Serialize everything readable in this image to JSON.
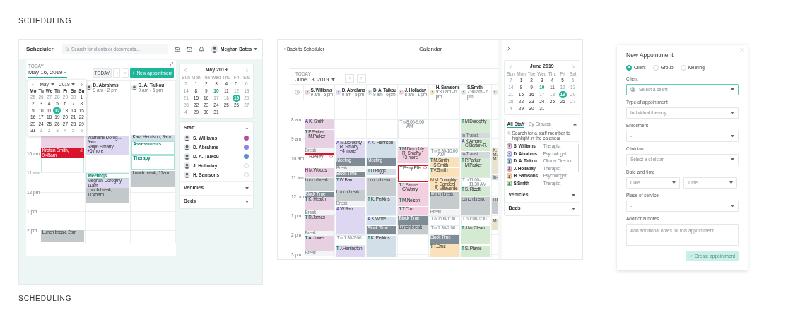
{
  "heading_top": "SCHEDULING",
  "heading_bottom": "SCHEDULING",
  "scheduler": {
    "app_title": "Scheduler",
    "search": {
      "placeholder": "Search for clients or documents..."
    },
    "user_name": "Meghan Bates",
    "calendar": {
      "today_label": "TODAY",
      "date": "May 16, 2019",
      "today_button": "TODAY",
      "new_button": "New appointment",
      "datepicker": {
        "month": "May",
        "year": "2019",
        "weekdays": [
          "Mo",
          "Tu",
          "We",
          "Th",
          "Fr",
          "Sa",
          "Su"
        ],
        "weeks": [
          [
            {
              "d": "25",
              "kind": "muted",
              "selected": false
            },
            {
              "d": "26",
              "kind": "muted",
              "selected": false
            },
            {
              "d": "27",
              "kind": "muted",
              "selected": false
            },
            {
              "d": "28",
              "kind": "muted",
              "selected": false
            },
            {
              "d": "29",
              "kind": "muted",
              "selected": false
            },
            {
              "d": "30",
              "kind": "muted",
              "selected": false
            },
            {
              "d": "1",
              "kind": "normal",
              "selected": false
            }
          ],
          [
            {
              "d": "2",
              "kind": "normal",
              "selected": false
            },
            {
              "d": "3",
              "kind": "normal",
              "selected": false
            },
            {
              "d": "4",
              "kind": "normal",
              "selected": false
            },
            {
              "d": "5",
              "kind": "normal",
              "selected": false
            },
            {
              "d": "6",
              "kind": "normal",
              "selected": false
            },
            {
              "d": "7",
              "kind": "normal",
              "selected": false
            },
            {
              "d": "8",
              "kind": "normal",
              "selected": false
            }
          ],
          [
            {
              "d": "9",
              "kind": "normal",
              "selected": false
            },
            {
              "d": "10",
              "kind": "normal",
              "selected": false
            },
            {
              "d": "11",
              "kind": "normal",
              "selected": false
            },
            {
              "d": "12",
              "kind": "normal",
              "selected": true
            },
            {
              "d": "13",
              "kind": "normal",
              "selected": false
            },
            {
              "d": "14",
              "kind": "normal",
              "selected": false
            },
            {
              "d": "15",
              "kind": "normal",
              "selected": false
            }
          ],
          [
            {
              "d": "16",
              "kind": "normal",
              "selected": false
            },
            {
              "d": "17",
              "kind": "normal",
              "selected": false
            },
            {
              "d": "18",
              "kind": "normal",
              "selected": false
            },
            {
              "d": "19",
              "kind": "normal",
              "selected": false
            },
            {
              "d": "20",
              "kind": "normal",
              "selected": false
            },
            {
              "d": "21",
              "kind": "normal",
              "selected": false
            },
            {
              "d": "22",
              "kind": "normal",
              "selected": false
            }
          ],
          [
            {
              "d": "23",
              "kind": "normal",
              "selected": false
            },
            {
              "d": "24",
              "kind": "normal",
              "selected": false
            },
            {
              "d": "25",
              "kind": "normal",
              "selected": false
            },
            {
              "d": "26",
              "kind": "normal",
              "selected": false
            },
            {
              "d": "27",
              "kind": "normal",
              "selected": false
            },
            {
              "d": "28",
              "kind": "normal",
              "selected": false
            },
            {
              "d": "29",
              "kind": "normal",
              "selected": false
            }
          ],
          [
            {
              "d": "31",
              "kind": "normal",
              "selected": false
            },
            {
              "d": "1",
              "kind": "muted",
              "selected": false
            },
            {
              "d": "2",
              "kind": "muted",
              "selected": false
            },
            {
              "d": "3",
              "kind": "muted",
              "selected": false
            },
            {
              "d": "4",
              "kind": "muted",
              "selected": false
            },
            {
              "d": "5",
              "kind": "muted",
              "selected": false
            },
            {
              "d": "6",
              "kind": "muted",
              "selected": false
            }
          ]
        ]
      },
      "hours": [
        "10 am",
        "11 am",
        "12 pm",
        "1 pm",
        "2 pm"
      ],
      "columns": [
        {
          "events": [
            {
              "kind": "outline"
            },
            {
              "kind": "appt",
              "color": "#ecd3e3"
            },
            {
              "kind": "alert",
              "lines": [
                "Kristen Smith, 9:45am"
              ]
            },
            {
              "kind": "lunch",
              "lines": [
                "Lunch break, 2pm"
              ]
            }
          ]
        },
        {
          "staff": {
            "name": "D. Abrahms",
            "hours": "9 am - 2 pm"
          },
          "events": [
            {
              "kind": "appt",
              "color": "#ddd7f2",
              "lines": [
                "Warriane Dorog..., 9am",
                "Ralph Smarty",
                "+6 more"
              ]
            },
            {
              "kind": "group",
              "lines": [
                "Meetings"
              ]
            },
            {
              "kind": "appt",
              "color": "#ddd7f2",
              "lines": [
                "Meghan Dorogthy, 11am"
              ]
            },
            {
              "kind": "lunch",
              "lines": [
                "Lunch break, 11:45am"
              ]
            }
          ]
        },
        {
          "staff": {
            "name": "D. A. Taikou",
            "hours": "9 am - 6 pm"
          },
          "events": [
            {
              "kind": "appt",
              "color": "#d3dfe8",
              "lines": [
                "Kara Henrison, 9am"
              ]
            },
            {
              "kind": "group",
              "lines": [
                "Assessments"
              ]
            },
            {
              "kind": "group",
              "lines": [
                "Therapy"
              ]
            },
            {
              "kind": "lunch",
              "lines": [
                "Lunch break, 11am"
              ]
            }
          ]
        }
      ]
    },
    "mini_calendar": {
      "title": "May 2019",
      "weekdays": [
        "Sun",
        "Mon",
        "Tue",
        "Wed",
        "Thu",
        "Fri",
        "Sat"
      ],
      "weeks": [
        [
          {
            "d": "7",
            "kind": "muted",
            "selected": false
          },
          {
            "d": "1",
            "kind": "normal",
            "selected": false
          },
          {
            "d": "2",
            "kind": "normal",
            "selected": false
          },
          {
            "d": "3",
            "kind": "normal",
            "selected": false
          },
          {
            "d": "4",
            "kind": "normal",
            "selected": false
          },
          {
            "d": "5",
            "kind": "normal",
            "selected": false
          },
          {
            "d": "6",
            "kind": "muted",
            "selected": false
          }
        ],
        [
          {
            "d": "14",
            "kind": "muted",
            "selected": false
          },
          {
            "d": "8",
            "kind": "normal",
            "selected": false
          },
          {
            "d": "9",
            "kind": "normal",
            "selected": false
          },
          {
            "d": "10",
            "kind": "today",
            "selected": false
          },
          {
            "d": "11",
            "kind": "normal",
            "selected": false
          },
          {
            "d": "12",
            "kind": "muted",
            "selected": false
          },
          {
            "d": "13",
            "kind": "muted",
            "selected": false
          }
        ],
        [
          {
            "d": "21",
            "kind": "muted",
            "selected": false
          },
          {
            "d": "15",
            "kind": "normal",
            "selected": false
          },
          {
            "d": "16",
            "kind": "normal",
            "selected": false
          },
          {
            "d": "17",
            "kind": "muted",
            "selected": false
          },
          {
            "d": "18",
            "kind": "muted",
            "selected": false
          },
          {
            "d": "19",
            "kind": "normal",
            "selected": true
          },
          {
            "d": "20",
            "kind": "muted",
            "selected": false
          }
        ],
        [
          {
            "d": "28",
            "kind": "muted",
            "selected": false
          },
          {
            "d": "22",
            "kind": "normal",
            "selected": false
          },
          {
            "d": "23",
            "kind": "normal",
            "selected": false
          },
          {
            "d": "24",
            "kind": "normal",
            "selected": false
          },
          {
            "d": "25",
            "kind": "normal",
            "selected": false
          },
          {
            "d": "26",
            "kind": "normal",
            "selected": false
          },
          {
            "d": "27",
            "kind": "muted",
            "selected": false
          }
        ],
        [
          {
            "d": "4",
            "kind": "muted",
            "selected": false
          },
          {
            "d": "29",
            "kind": "normal",
            "selected": false
          },
          {
            "d": "30",
            "kind": "normal",
            "selected": false
          },
          {
            "d": "31",
            "kind": "normal",
            "selected": false
          }
        ]
      ]
    },
    "sections": [
      {
        "title": "Staff",
        "expanded": true,
        "items": [
          {
            "name": "S. Williams",
            "checked": true,
            "color": "#b04fa0"
          },
          {
            "name": "D. Abrahms",
            "checked": true,
            "color": "#8f84e6"
          },
          {
            "name": "D. A. Taikou",
            "checked": true,
            "color": "#5f8ec4"
          },
          {
            "name": "J. Holladay",
            "checked": false
          },
          {
            "name": "H. Samsons",
            "checked": false
          }
        ]
      },
      {
        "title": "Vehicles",
        "expanded": false
      },
      {
        "title": "Beds",
        "expanded": false
      }
    ]
  },
  "calendar_screen": {
    "back_link": "Back to Scheduler",
    "title": "Calendar",
    "today_label": "TODAY",
    "date": "June 13, 2019",
    "hours": [
      "8 am",
      "9 am",
      "10 am",
      "11 am",
      "12 pm",
      "1 pm",
      "2 pm",
      "3 pm"
    ],
    "columns": [
      {
        "staff": {
          "name": "S. Williams",
          "hours": "9 am - 5 pm"
        },
        "color": "#e6d0e2",
        "events": [
          {
            "kind": "appt",
            "type": "A",
            "lines": [
              "K. Smith"
            ]
          },
          {
            "kind": "appt",
            "type": "T",
            "lines": [
              "P.Parker",
              "M.Parker"
            ]
          },
          {
            "kind": "break",
            "lines": [
              "Break"
            ]
          },
          {
            "kind": "alert",
            "type": "T",
            "lines": [
              "R.Perry"
            ]
          },
          {
            "kind": "appt",
            "type": "H",
            "lines": [
              "M.Woods"
            ]
          },
          {
            "kind": "lunch",
            "lines": [
              "Lunch break"
            ]
          },
          {
            "kind": "block",
            "lines": [
              "Block Time"
            ]
          },
          {
            "kind": "appt",
            "type": "T",
            "lines": [
              "K. Hearth"
            ]
          },
          {
            "kind": "break",
            "lines": [
              "Break"
            ]
          },
          {
            "kind": "appt",
            "type": "T",
            "lines": [
              "R.James"
            ]
          },
          {
            "kind": "break",
            "lines": [
              "Break"
            ]
          },
          {
            "kind": "appt",
            "type": "T",
            "lines": [
              "A. Jones"
            ]
          },
          {
            "kind": "break",
            "lines": [
              "Break"
            ]
          }
        ]
      },
      {
        "staff": {
          "name": "D. Abrahms",
          "hours": "9 am - 5 pm"
        },
        "color": "#ddd7f2",
        "events": [
          {
            "kind": "appt",
            "type": "A",
            "lines": [
              "M.Doroghty",
              "R. Smarty",
              "+4 more"
            ]
          },
          {
            "kind": "meeting",
            "lines": [
              "Meeting"
            ]
          },
          {
            "kind": "break",
            "lines": [
              "Break"
            ]
          },
          {
            "kind": "block",
            "lines": [
              "Block Time"
            ]
          },
          {
            "kind": "appt",
            "type": "T",
            "lines": [
              "W.Barr"
            ]
          },
          {
            "kind": "lunch",
            "lines": [
              "Lunch break"
            ]
          },
          {
            "kind": "break",
            "lines": [
              "Break"
            ]
          },
          {
            "kind": "appt",
            "type": "A",
            "lines": [
              "W.Barr"
            ]
          },
          {
            "kind": "open",
            "type": "T",
            "lines": [
              "1:30-2:00"
            ]
          },
          {
            "kind": "appt",
            "type": "T",
            "lines": [
              "J.Harrington"
            ]
          }
        ]
      },
      {
        "staff": {
          "name": "D. A. Taikou",
          "hours": "9 am - 6 pm"
        },
        "color": "#d3dfe8",
        "events": [
          {
            "kind": "appt",
            "type": "A",
            "lines": [
              "K. Henrison"
            ]
          },
          {
            "kind": "meeting",
            "lines": [
              "Meeting"
            ]
          },
          {
            "kind": "appt",
            "type": "T",
            "lines": [
              "D.Riggs"
            ]
          },
          {
            "kind": "lunch",
            "lines": [
              "Lunch break"
            ]
          },
          {
            "kind": "appt",
            "type": "T",
            "lines": [
              "K. Perkins"
            ]
          },
          {
            "kind": "appt",
            "type": "A",
            "lines": [
              "K.White"
            ]
          },
          {
            "kind": "block",
            "lines": [
              "Block Time"
            ]
          },
          {
            "kind": "appt",
            "type": "T",
            "lines": [
              "K. Perkins"
            ]
          }
        ]
      },
      {
        "staff": {
          "name": "J. Holladay",
          "hours": "8 am - 1 pm"
        },
        "color": "#f3d0e1",
        "events": [
          {
            "kind": "open",
            "type": "T",
            "lines": [
              "8:00-9:00 AM"
            ]
          },
          {
            "kind": "appt",
            "type": "T",
            "lines": [
              "M.Doroghty",
              "R. Smarty",
              "+3 more"
            ]
          },
          {
            "kind": "alert",
            "type": "T",
            "lines": [
              "Perry Ellis"
            ]
          },
          {
            "kind": "appt",
            "type": "T",
            "lines": [
              "J.Farmer",
              "G.Warry"
            ]
          },
          {
            "kind": "appt",
            "type": "T",
            "lines": [
              "M.Nelson"
            ]
          },
          {
            "kind": "appt",
            "type": "T",
            "lines": [
              "T.Cruz"
            ]
          },
          {
            "kind": "block",
            "lines": [
              "Block Time"
            ]
          },
          {
            "kind": "lunch",
            "lines": [
              "Lunch break"
            ]
          }
        ]
      },
      {
        "staff": {
          "name": "H. Samsons",
          "hours": "9:30 am - 6 pm"
        },
        "color": "#fbe1b9",
        "events": [
          {
            "kind": "open",
            "type": "T",
            "lines": [
              "9:30-10:00 AM"
            ]
          },
          {
            "kind": "appt",
            "type": "T",
            "lines": [
              "M.Smith",
              "S.Smith"
            ]
          },
          {
            "kind": "appt",
            "type": "T",
            "lines": [
              "V.Smith"
            ]
          },
          {
            "kind": "appt",
            "type": "M",
            "lines": [
              "M.Doroghty",
              "S. Sanders",
              "A. Villaverde"
            ]
          },
          {
            "kind": "lunch",
            "lines": [
              "Lunch break"
            ]
          },
          {
            "kind": "break",
            "lines": [
              "Break"
            ]
          },
          {
            "kind": "open",
            "type": "T",
            "lines": [
              "1:00-1:30"
            ]
          },
          {
            "kind": "open",
            "type": "T",
            "lines": [
              "1:30-2:00"
            ]
          },
          {
            "kind": "block",
            "lines": [
              "Block Time"
            ]
          },
          {
            "kind": "appt",
            "type": "T",
            "lines": [
              "T.Cruz"
            ]
          }
        ]
      },
      {
        "staff": {
          "name": "S.Smith",
          "hours": "7:30 am - 6 pm"
        },
        "color": "#d5ead3",
        "events": [
          {
            "kind": "appt",
            "type": "T",
            "lines": [
              "M.Doroghty"
            ]
          },
          {
            "kind": "transit",
            "lines": [
              "In-Transit"
            ]
          },
          {
            "kind": "appt",
            "type": "A",
            "lines": [
              "K.Amaro",
              "C.Barton-R."
            ]
          },
          {
            "kind": "transit",
            "lines": [
              "In-Transit"
            ]
          },
          {
            "kind": "appt",
            "type": "T",
            "lines": [
              "P.Parker",
              "M.Parker"
            ]
          },
          {
            "kind": "open",
            "type": "T",
            "lines": [
              "11:00-11:30 AM"
            ]
          },
          {
            "kind": "appt",
            "type": "T",
            "lines": [
              "S. Ricetti"
            ]
          },
          {
            "kind": "lunch",
            "lines": [
              "Lunch break"
            ]
          },
          {
            "kind": "open",
            "type": "T",
            "lines": [
              "1:00-1:30"
            ]
          },
          {
            "kind": "appt",
            "type": "T",
            "lines": [
              "J.McClean"
            ]
          },
          {
            "kind": "appt",
            "type": "T",
            "lines": [
              "S. Pierce"
            ]
          }
        ]
      },
      {
        "color": "#e8e3cf",
        "events": [
          {
            "kind": "appt",
            "lines": [
              "K.",
              "M.",
              "M."
            ]
          },
          {
            "kind": "transit",
            "lines": [
              "In-"
            ]
          },
          {
            "kind": "lunch",
            "lines": [
              "Lu"
            ]
          },
          {
            "kind": "appt",
            "lines": [
              "M."
            ]
          }
        ]
      }
    ],
    "mini_calendar": {
      "title": "June 2019",
      "weekdays": [
        "Sun",
        "Mon",
        "Tue",
        "Wed",
        "Thu",
        "Fri",
        "Sat"
      ],
      "weeks": [
        [
          {
            "d": "7",
            "kind": "muted",
            "selected": false
          },
          {
            "d": "1",
            "kind": "normal",
            "selected": false
          },
          {
            "d": "2",
            "kind": "normal",
            "selected": false
          },
          {
            "d": "3",
            "kind": "normal",
            "selected": false
          },
          {
            "d": "4",
            "kind": "normal",
            "selected": false
          },
          {
            "d": "5",
            "kind": "normal",
            "selected": false
          },
          {
            "d": "6",
            "kind": "muted",
            "selected": false
          }
        ],
        [
          {
            "d": "14",
            "kind": "muted",
            "selected": false
          },
          {
            "d": "8",
            "kind": "normal",
            "selected": false
          },
          {
            "d": "9",
            "kind": "normal",
            "selected": false
          },
          {
            "d": "10",
            "kind": "today",
            "selected": false
          },
          {
            "d": "11",
            "kind": "normal",
            "selected": false
          },
          {
            "d": "12",
            "kind": "muted",
            "selected": false
          },
          {
            "d": "13",
            "kind": "muted",
            "selected": false
          }
        ],
        [
          {
            "d": "21",
            "kind": "muted",
            "selected": false
          },
          {
            "d": "15",
            "kind": "normal",
            "selected": false
          },
          {
            "d": "16",
            "kind": "normal",
            "selected": false
          },
          {
            "d": "17",
            "kind": "muted",
            "selected": false
          },
          {
            "d": "18",
            "kind": "muted",
            "selected": false
          },
          {
            "d": "19",
            "kind": "normal",
            "selected": true
          },
          {
            "d": "20",
            "kind": "muted",
            "selected": false
          }
        ],
        [
          {
            "d": "28",
            "kind": "muted",
            "selected": false
          },
          {
            "d": "22",
            "kind": "normal",
            "selected": false
          },
          {
            "d": "23",
            "kind": "normal",
            "selected": false
          },
          {
            "d": "24",
            "kind": "normal",
            "selected": false
          },
          {
            "d": "25",
            "kind": "normal",
            "selected": false
          },
          {
            "d": "26",
            "kind": "normal",
            "selected": false
          },
          {
            "d": "27",
            "kind": "muted",
            "selected": false
          }
        ],
        [
          {
            "d": "4",
            "kind": "muted",
            "selected": false
          },
          {
            "d": "29",
            "kind": "normal",
            "selected": false
          },
          {
            "d": "30",
            "kind": "normal",
            "selected": false
          },
          {
            "d": "31",
            "kind": "normal",
            "selected": false
          }
        ]
      ]
    },
    "staff_panel": {
      "tabs": [
        {
          "label": "All Staff",
          "selected": true
        },
        {
          "label": "By Groups",
          "selected": false
        }
      ],
      "expanded": true,
      "search": {
        "placeholder": "Search for a staff member to highlight in the calendar"
      },
      "items": [
        {
          "name": "S. Williams",
          "role": "Therapist",
          "color": "#c98fbd"
        },
        {
          "name": "D. Abrahms",
          "role": "Psychologist",
          "color": "#a99fe3"
        },
        {
          "name": "D. A. Taikou",
          "role": "Clinical Director",
          "color": "#8eaed0"
        },
        {
          "name": "J. Holladay",
          "role": "Therapist",
          "color": "#e89ab9"
        },
        {
          "name": "H. Samsons",
          "role": "Psychologist",
          "color": "#f3b860"
        },
        {
          "name": "S.Smith",
          "role": "Therapist",
          "color": "#8fcf8b"
        }
      ]
    },
    "sections": [
      {
        "title": "Vehicles",
        "expanded": false
      },
      {
        "title": "Beds",
        "expanded": false
      }
    ]
  },
  "new_appointment": {
    "title": "New Appointment",
    "radios": [
      {
        "label": "Client",
        "selected": true
      },
      {
        "label": "Group",
        "selected": false
      },
      {
        "label": "Meeting",
        "selected": false
      }
    ],
    "fields": [
      {
        "kind": "person",
        "label": "Client",
        "placeholder": "Select a client",
        "focused": true
      },
      {
        "kind": "select",
        "label": "Type of appointment",
        "placeholder": "Individual therapy",
        "focused": false
      },
      {
        "kind": "select",
        "label": "Enrollment",
        "placeholder": "-",
        "focused": false
      },
      {
        "kind": "select",
        "label": "Clinician",
        "placeholder": "Select a clinician",
        "focused": false
      },
      {
        "kind": "pair",
        "label": "Date and time",
        "parts": [
          {
            "placeholder": "Date"
          },
          {
            "placeholder": "Time"
          }
        ],
        "focused": false
      },
      {
        "kind": "select",
        "label": "Place of service",
        "placeholder": "-",
        "focused": false
      },
      {
        "kind": "textarea",
        "label": "Additional notes",
        "placeholder": "Add additional notes for this appointment...",
        "focused": false
      }
    ],
    "submit": {
      "label": "Create appointment",
      "disabled": true
    }
  }
}
